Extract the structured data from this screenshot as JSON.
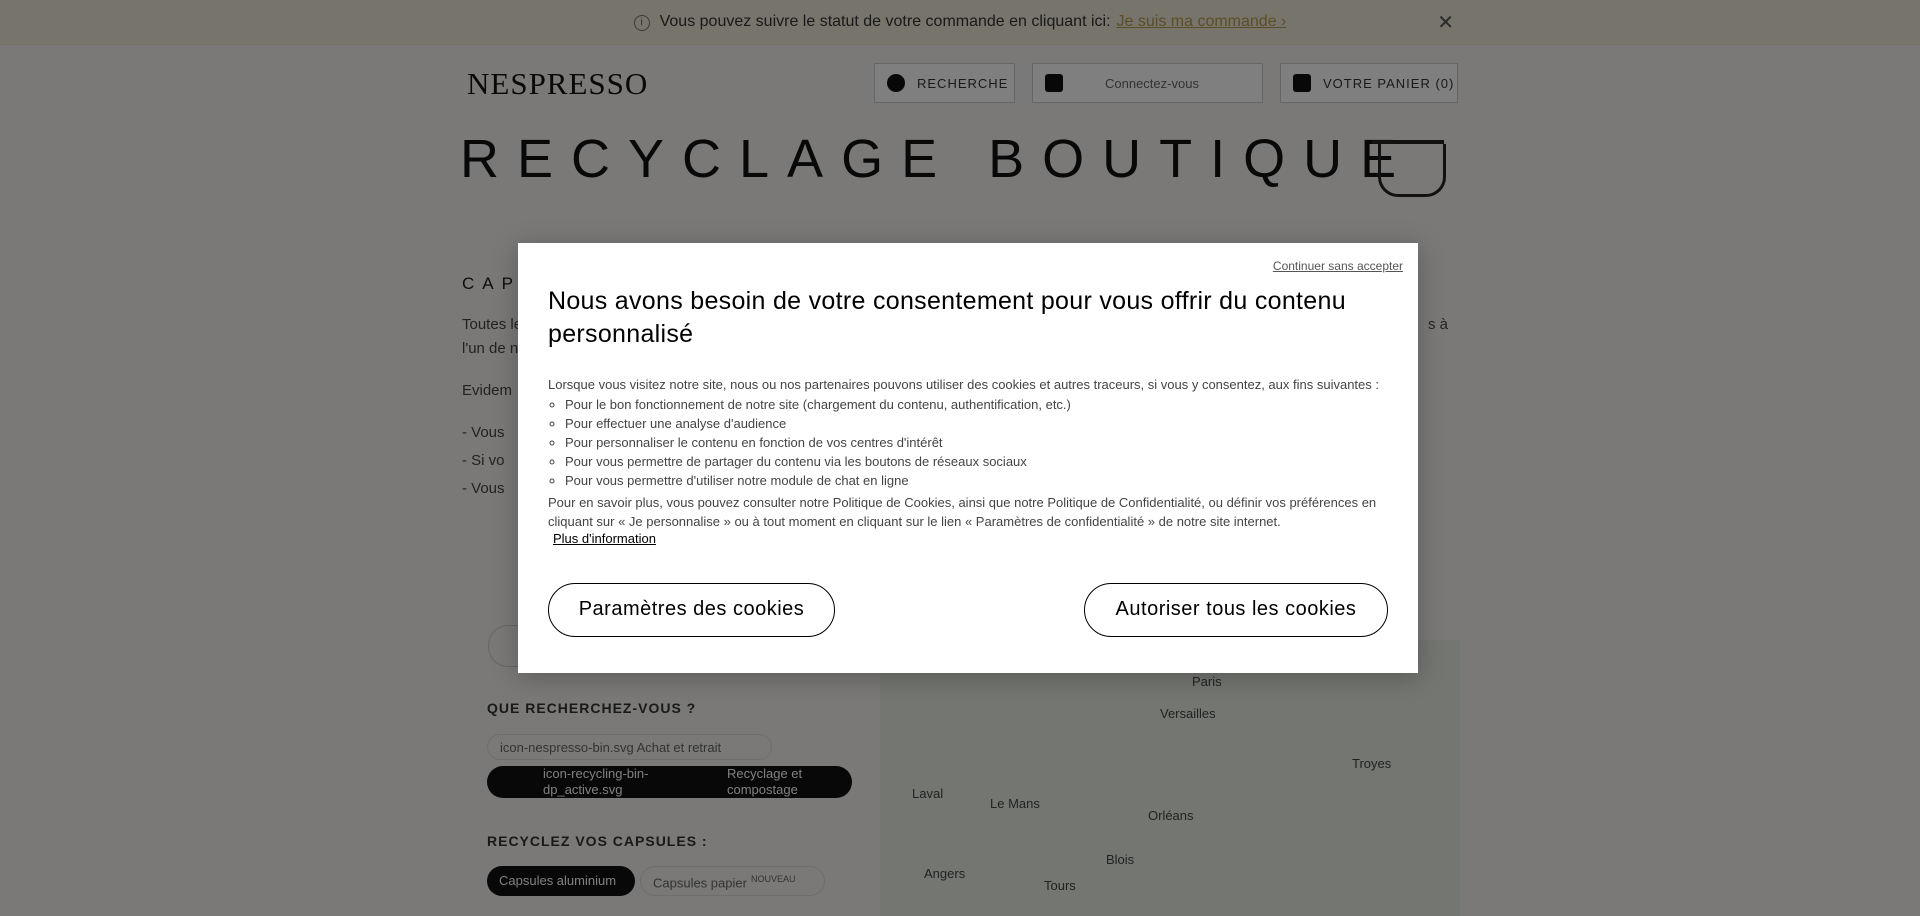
{
  "notice": {
    "info_icon": "info-icon",
    "text": "Vous pouvez suivre le statut de votre commande en cliquant ici:",
    "link": "Je suis ma commande ›",
    "close_icon": "close-icon"
  },
  "header": {
    "logo": "NESPRESSO",
    "search": "RECHERCHE",
    "login": "Connectez-vous",
    "cart": "VOTRE PANIER (0)"
  },
  "page": {
    "title": "RECYCLAGE BOUTIQUE",
    "section": "CAP",
    "para_start": "Toutes le",
    "para_start2": "l'un de n",
    "para_right": "s à",
    "evid": "Evidem",
    "bullets": [
      "- Vous",
      "- Si vo",
      "- Vous"
    ],
    "search_heading": "QUE RECHERCHEZ-VOUS ?",
    "chip_1": "icon-nespresso-bin.svg  Achat et retrait",
    "chip_2a": "icon-recycling-bin-",
    "chip_2b": "Recyclage et",
    "chip_2c": "dp_active.svg",
    "chip_2d": "compostage",
    "recycle_heading": "RECYCLEZ VOS CAPSULES :",
    "tab_1": "Capsules aluminium",
    "tab_2": "Capsules papier",
    "tab_2_badge": "NOUVEAU",
    "map_towns": [
      "Paris",
      "Versailles",
      "Troyes",
      "Laval",
      "Le Mans",
      "Orléans",
      "Blois",
      "Angers",
      "Tours"
    ]
  },
  "consent": {
    "skip": "Continuer sans accepter",
    "title": "Nous avons besoin de votre consentement pour vous offrir du contenu personnalisé",
    "intro": "Lorsque vous visitez notre site, nous ou nos partenaires pouvons utiliser des cookies et autres traceurs, si vous y consentez, aux fins suivantes :",
    "purposes": [
      "Pour le bon fonctionnement de notre site (chargement du contenu, authentification, etc.)",
      "Pour effectuer une analyse d'audience",
      "Pour personnaliser le contenu en fonction de vos centres d'intérêt",
      "Pour vous permettre de partager du contenu via les boutons de réseaux sociaux",
      "Pour vous permettre d'utiliser notre module de chat en ligne"
    ],
    "more": "Pour en savoir plus, vous pouvez consulter notre Politique de Cookies, ainsi que notre Politique de Confidentialité, ou définir vos préférences en cliquant sur « Je personnalise » ou à tout moment en cliquant sur le lien « Paramètres de confidentialité » de notre site internet.",
    "plus_info": "Plus d'information",
    "params_button": "Paramètres des cookies",
    "allow_button": "Autoriser tous les cookies"
  }
}
